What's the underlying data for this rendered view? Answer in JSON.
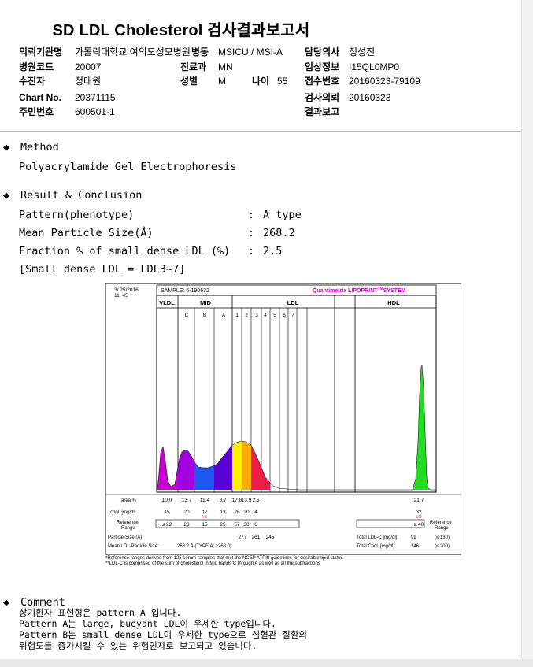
{
  "header": {
    "title": "SD LDL Cholesterol 검사결과보고서"
  },
  "info": {
    "institution_label": "의뢰기관명",
    "institution_value": "가톨릭대학교 여의도성모병원",
    "dept_label": "병동",
    "dept_value": "MSICU / MSI-A",
    "doctor_label": "담당의사",
    "doctor_value": "정성진",
    "hospital_code_label": "병원코드",
    "hospital_code_value": "20007",
    "clinic_label": "진료과",
    "clinic_value": "MN",
    "clinical_label": "임상정보",
    "clinical_value": "I15QL0MP0",
    "patient_label": "수진자",
    "patient_value": "정대원",
    "sex_label": "성별",
    "sex_value": "M",
    "age_label": "나이",
    "age_value": "55",
    "receipt_label": "접수번호",
    "receipt_value": "20160323-79109",
    "chart_label": "Chart No.",
    "chart_value": "20371115",
    "test_label": "검사의뢰",
    "test_value": "20160323",
    "rrn_label": "주민번호",
    "rrn_value": "600501-1",
    "report_label": "결과보고",
    "report_value": ""
  },
  "method": {
    "heading": "Method",
    "text": "Polyacrylamide Gel Electrophoresis"
  },
  "result": {
    "heading": "Result & Conclusion",
    "pattern_label": "Pattern(phenotype)",
    "pattern_value": "A type",
    "size_label": "Mean Particle Size(Å)",
    "size_value": "268.2",
    "fraction_label": "Fraction % of small dense LDL (%)",
    "fraction_value": "2.5",
    "note": "[Small dense LDL = LDL3~7]",
    "colon": ":"
  },
  "chart": {
    "date": "3/ 25/2016",
    "time": "11: 45",
    "sample": "SAMPLE:   6-190632",
    "brand": "Quantimetrix LIPOPRINT",
    "brand_tm": "TM",
    "brand_suffix": "SYSTEM",
    "vldl": "VLDL",
    "mid": "MID",
    "ldl": "LDL",
    "hdl": "HDL",
    "sub_labels": [
      "C",
      "B",
      "A",
      "1",
      "2",
      "3",
      "4",
      "5",
      "6",
      "7"
    ],
    "area_label": "area %",
    "chol_label": "chol. [mg/dl]",
    "ref_label1": "Reference",
    "ref_label2": "Range",
    "ref_label_r1": "Reference",
    "ref_label_r2": "Range",
    "area_values": [
      "10.0",
      "13.7",
      "11.4",
      "8.7",
      "17.8",
      "13.9",
      "2.5"
    ],
    "hdl_area": "21.7",
    "chol_values": [
      "15",
      "20",
      "17",
      "13",
      "26",
      "20",
      "4"
    ],
    "hi_flag": "HI",
    "hdl_chol": "32",
    "lo_flag": "LO",
    "ref_values": [
      "≤ 22",
      "23",
      "15",
      "25",
      "57",
      "30",
      "6"
    ],
    "hdl_ref": "≥ 40",
    "ps_label": "Particle-Size (Å)",
    "ps_values": [
      "277",
      "261",
      "245"
    ],
    "total_ldl_label": "Total LDL-C [mg/dl]:",
    "total_ldl_value": "99",
    "total_ldl_ref": "(≤ 130)",
    "mean_label": "Mean LDL-Particle Size:",
    "mean_value": "268.2 Å   (TYPE A; ≥268.0)",
    "total_chol_label": "Total Chol. [mg/dl]:",
    "total_chol_value": "146",
    "total_chol_ref": "(≤ 200)",
    "foot1": "*Reference ranges derived from 125 serum samples that met the NCEP ATPIII guidelines for desirable lipid status",
    "foot2": "**LDL-C is comprised of the sum of cholesterol in Mid bands C through A as well as all the subfractions"
  },
  "chart_data": {
    "type": "area",
    "bands": [
      "VLDL",
      "MID-C",
      "MID-B",
      "MID-A",
      "LDL1",
      "LDL2",
      "LDL3",
      "HDL"
    ],
    "area_percent": [
      10.0,
      13.7,
      11.4,
      8.7,
      17.8,
      13.9,
      2.5,
      21.7
    ],
    "cholesterol_mg_dl": [
      15,
      20,
      17,
      13,
      26,
      20,
      4,
      32
    ],
    "colors": {
      "VLDL": "#c800d2",
      "MID-C": "#a300e0",
      "MID-B": "#1e58f2",
      "MID-A": "#5a00d8",
      "LDL1": "#ffee00",
      "LDL2": "#ffaa00",
      "LDL3": "#ee1c48",
      "HDL": "#22dd22"
    }
  },
  "comment": {
    "heading": "Comment",
    "lines": [
      "상기환자 표현형은 pattern A 입니다.",
      "Pattern A는 large, buoyant LDL이 우세한 type입니다.",
      "Pattern B는 small dense LDL이 우세한 type으로 심혈관 질환의",
      "위험도를 증가시킬 수 있는 위험인자로 보고되고 있습니다."
    ]
  }
}
